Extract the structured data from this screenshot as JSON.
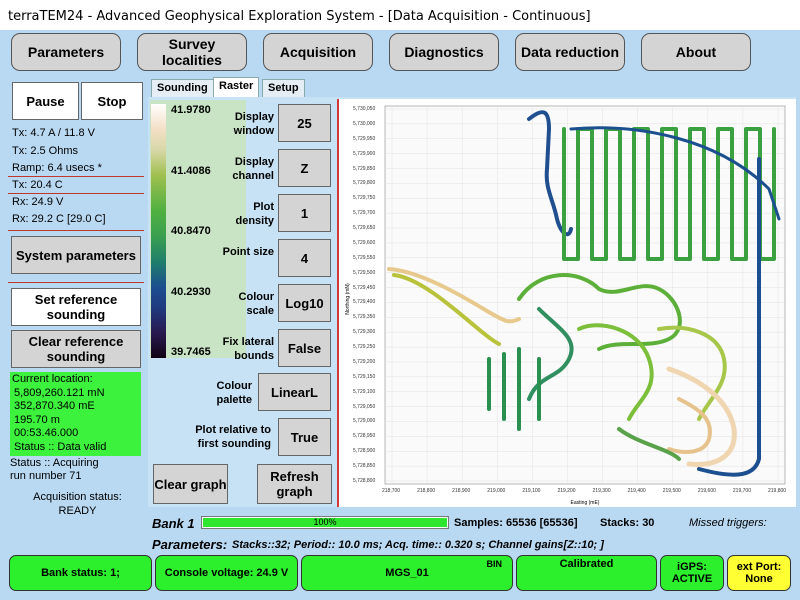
{
  "window": {
    "title": "terraTEM24 - Advanced Geophysical Exploration System - [Data Acquisition - Continuous]"
  },
  "top_nav": [
    {
      "id": "parameters",
      "label": "Parameters"
    },
    {
      "id": "survey",
      "label": "Survey localities"
    },
    {
      "id": "acquisition",
      "label": "Acquisition"
    },
    {
      "id": "diagnostics",
      "label": "Diagnostics"
    },
    {
      "id": "reduction",
      "label": "Data reduction"
    },
    {
      "id": "about",
      "label": "About"
    }
  ],
  "left_panel": {
    "pause_label": "Pause",
    "stop_label": "Stop",
    "tx_current": "Tx: 4.7 A / 11.8 V",
    "tx_resistance": "Tx: 2.5 Ohms",
    "ramp": "Ramp:   6.4 usecs *",
    "tx_temp": "Tx: 20.4 C",
    "rx_voltage": "Rx: 24.9 V",
    "rx_temp": "Rx: 29.2 C [29.0 C]",
    "system_params_label": "System parameters",
    "set_reference_label": "Set reference sounding",
    "clear_reference_label": "Clear reference sounding",
    "location": {
      "heading": "Current location:",
      "northing": "5,809,260.121 mN",
      "easting": "352,870.340 mE",
      "elevation": "195.70 m",
      "time": "00:53.46.000",
      "status": "Status :: Data valid"
    },
    "acq_status_line1": "Status :: Acquiring",
    "acq_status_line2": "run number 71",
    "acquisition_status_label": "Acquisition status:",
    "acquisition_status_value": "READY"
  },
  "tabs": [
    {
      "id": "sounding",
      "label": "Sounding",
      "active": false
    },
    {
      "id": "raster",
      "label": "Raster",
      "active": true
    },
    {
      "id": "setup",
      "label": "Setup",
      "active": false
    }
  ],
  "colour_scale": {
    "labels": [
      "41.9780",
      "41.4086",
      "40.8470",
      "40.2930",
      "39.7465"
    ]
  },
  "controls": {
    "display_window": {
      "label": "Display window",
      "value": "25"
    },
    "display_channel": {
      "label": "Display channel",
      "value": "Z"
    },
    "plot_density": {
      "label": "Plot density",
      "value": "1"
    },
    "point_size": {
      "label": "Point size",
      "value": "4"
    },
    "colour_scale": {
      "label": "Colour scale",
      "value": "Log10"
    },
    "fix_lateral": {
      "label": "Fix lateral bounds",
      "value": "False"
    },
    "colour_palette": {
      "label": "Colour palette",
      "value": "LinearL"
    },
    "plot_relative": {
      "label": "Plot relative to first sounding",
      "value": "True"
    },
    "clear_graph_label": "Clear graph",
    "refresh_graph_label": "Refresh graph"
  },
  "plot": {
    "ylabel": "Northing (mN)",
    "xlabel": "Easting (mE)",
    "y_ticks": [
      "5,730,050",
      "5,730,000",
      "5,729,950",
      "5,729,900",
      "5,729,850",
      "5,729,800",
      "5,729,750",
      "5,729,700",
      "5,729,650",
      "5,729,600",
      "5,729,550",
      "5,729,500",
      "5,729,450",
      "5,729,400",
      "5,729,350",
      "5,729,300",
      "5,729,250",
      "5,729,200",
      "5,729,150",
      "5,729,100",
      "5,729,050",
      "5,729,000",
      "5,728,950",
      "5,728,900",
      "5,728,850",
      "5,728,800"
    ],
    "x_ticks": [
      "218,700",
      "218,800",
      "218,900",
      "219,000",
      "219,100",
      "219,200",
      "219,300",
      "219,400",
      "219,500",
      "219,600",
      "219,700",
      "219,800"
    ]
  },
  "bottom": {
    "bank_label": "Bank 1",
    "progress_percent": 100,
    "progress_text": "100%",
    "samples": "Samples:  65536 [65536]",
    "stacks": "Stacks: 30",
    "missed_triggers": "Missed triggers:",
    "parameters_label": "Parameters:",
    "parameters_text": "Stacks::32; Period:: 10.0 ms; Acq. time:: 0.320 s; Channel gains[Z::10; ]"
  },
  "status_bar": {
    "bank_status": "Bank status: 1;",
    "console_voltage": "Console voltage: 24.9 V",
    "bin_label": "BIN",
    "device": "MGS_01",
    "calibrated": "Calibrated",
    "igps": "iGPS: ACTIVE",
    "ext_port": "ext Port: None"
  },
  "colors": {
    "frame_bg": "#b9d8f2",
    "status_green": "#2bf02b",
    "status_yellow": "#ffff33",
    "accent_red": "#d43a3a"
  }
}
